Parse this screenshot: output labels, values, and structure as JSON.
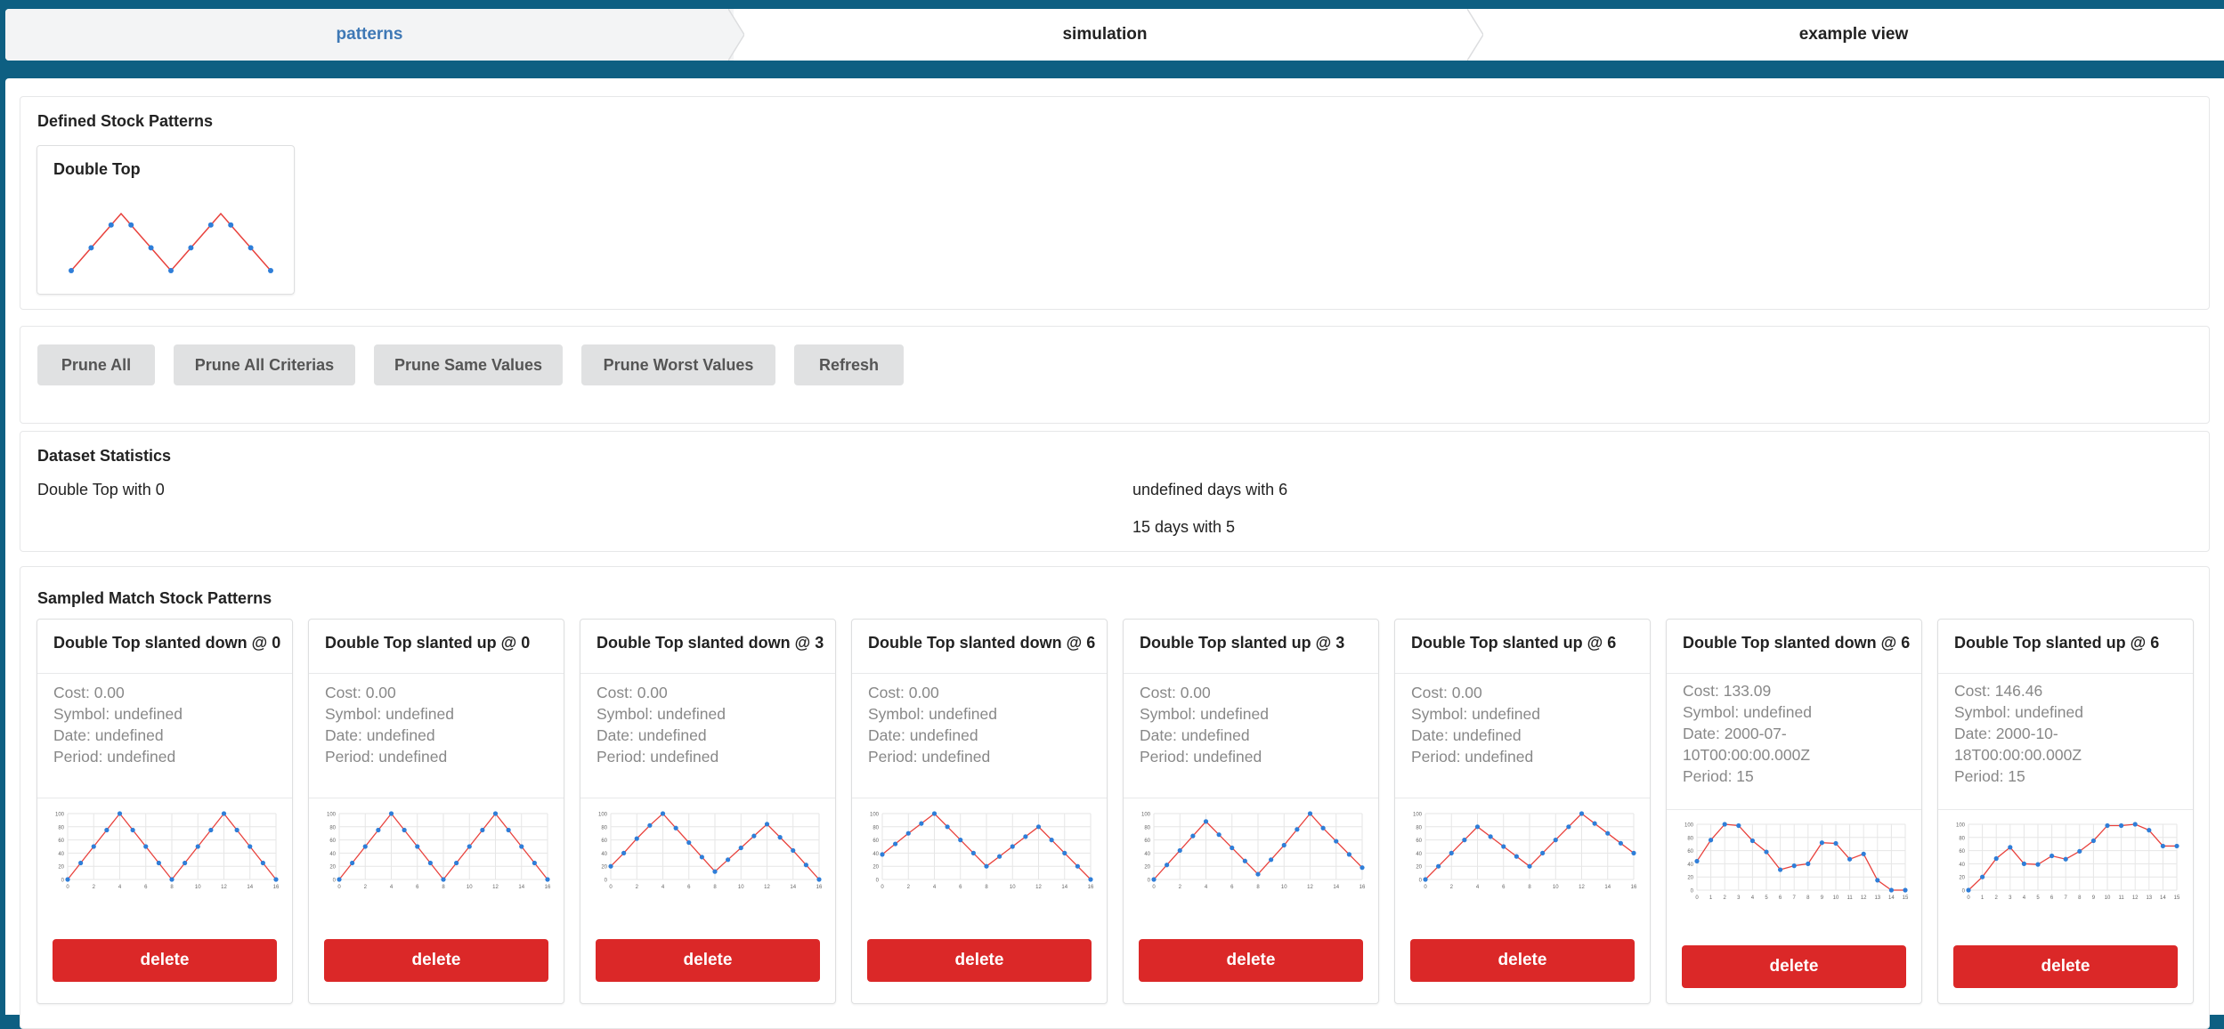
{
  "nav": {
    "steps": [
      {
        "label": "patterns"
      },
      {
        "label": "simulation"
      },
      {
        "label": "example view"
      }
    ]
  },
  "defined": {
    "title": "Defined Stock Patterns",
    "patterns": [
      {
        "name": "Double Top",
        "values": [
          0,
          20,
          40,
          60,
          80,
          100,
          80,
          60,
          40,
          20,
          0,
          20,
          40,
          60,
          80,
          100,
          80,
          60,
          40,
          20,
          0
        ]
      }
    ]
  },
  "toolbar": {
    "prune_all": "Prune All",
    "prune_all_criterias": "Prune All Criterias",
    "prune_same_values": "Prune Same Values",
    "prune_worst_values": "Prune Worst Values",
    "refresh": "Refresh"
  },
  "stats": {
    "title": "Dataset Statistics",
    "left": [
      "Double Top with 0"
    ],
    "right": [
      "undefined days with 6",
      "15 days with 5"
    ]
  },
  "sampled": {
    "title": "Sampled Match Stock Patterns",
    "delete_label": "delete",
    "colors": {
      "line": "#e8413c",
      "point": "#2f7ed8",
      "grid": "#e6e6e6",
      "delete": "#db2828"
    },
    "cards": [
      {
        "title": "Double Top slanted down @ 0",
        "cost": "Cost: 0.00",
        "symbol": "Symbol: undefined",
        "date": "Date: undefined",
        "period": "Period: undefined",
        "chart_data": {
          "type": "line",
          "x": [
            0,
            1,
            2,
            3,
            4,
            5,
            6,
            7,
            8,
            9,
            10,
            11,
            12,
            13,
            14,
            15,
            16
          ],
          "values": [
            0,
            25,
            50,
            75,
            100,
            75,
            50,
            25,
            0,
            25,
            50,
            75,
            100,
            75,
            50,
            25,
            0
          ],
          "ylim": [
            0,
            100
          ],
          "x_ticks": [
            "0",
            "2",
            "4",
            "6",
            "8",
            "10",
            "12",
            "14",
            "16"
          ],
          "y_ticks": [
            "0",
            "20",
            "40",
            "60",
            "80",
            "100"
          ]
        }
      },
      {
        "title": "Double Top slanted up @ 0",
        "cost": "Cost: 0.00",
        "symbol": "Symbol: undefined",
        "date": "Date: undefined",
        "period": "Period: undefined",
        "chart_data": {
          "type": "line",
          "x": [
            0,
            1,
            2,
            3,
            4,
            5,
            6,
            7,
            8,
            9,
            10,
            11,
            12,
            13,
            14,
            15,
            16
          ],
          "values": [
            0,
            25,
            50,
            75,
            100,
            75,
            50,
            25,
            0,
            25,
            50,
            75,
            100,
            75,
            50,
            25,
            0
          ],
          "ylim": [
            0,
            100
          ],
          "x_ticks": [
            "0",
            "2",
            "4",
            "6",
            "8",
            "10",
            "12",
            "14",
            "16"
          ],
          "y_ticks": [
            "0",
            "20",
            "40",
            "60",
            "80",
            "100"
          ]
        }
      },
      {
        "title": "Double Top slanted down @ 3",
        "cost": "Cost: 0.00",
        "symbol": "Symbol: undefined",
        "date": "Date: undefined",
        "period": "Period: undefined",
        "chart_data": {
          "type": "line",
          "x": [
            0,
            1,
            2,
            3,
            4,
            5,
            6,
            7,
            8,
            9,
            10,
            11,
            12,
            13,
            14,
            15,
            16
          ],
          "values": [
            20,
            40,
            62,
            82,
            100,
            78,
            56,
            34,
            12,
            30,
            48,
            66,
            84,
            64,
            44,
            22,
            0
          ],
          "ylim": [
            0,
            100
          ],
          "x_ticks": [
            "0",
            "2",
            "4",
            "6",
            "8",
            "10",
            "12",
            "14",
            "16"
          ],
          "y_ticks": [
            "0",
            "20",
            "40",
            "60",
            "80",
            "100"
          ]
        }
      },
      {
        "title": "Double Top slanted down @ 6",
        "cost": "Cost: 0.00",
        "symbol": "Symbol: undefined",
        "date": "Date: undefined",
        "period": "Period: undefined",
        "chart_data": {
          "type": "line",
          "x": [
            0,
            1,
            2,
            3,
            4,
            5,
            6,
            7,
            8,
            9,
            10,
            11,
            12,
            13,
            14,
            15,
            16
          ],
          "values": [
            38,
            54,
            70,
            85,
            100,
            80,
            60,
            40,
            20,
            35,
            50,
            65,
            80,
            60,
            40,
            20,
            0
          ],
          "ylim": [
            0,
            100
          ],
          "x_ticks": [
            "0",
            "2",
            "4",
            "6",
            "8",
            "10",
            "12",
            "14",
            "16"
          ],
          "y_ticks": [
            "0",
            "20",
            "40",
            "60",
            "80",
            "100"
          ]
        }
      },
      {
        "title": "Double Top slanted up @ 3",
        "cost": "Cost: 0.00",
        "symbol": "Symbol: undefined",
        "date": "Date: undefined",
        "period": "Period: undefined",
        "chart_data": {
          "type": "line",
          "x": [
            0,
            1,
            2,
            3,
            4,
            5,
            6,
            7,
            8,
            9,
            10,
            11,
            12,
            13,
            14,
            15,
            16
          ],
          "values": [
            0,
            22,
            44,
            66,
            88,
            68,
            48,
            28,
            8,
            30,
            52,
            76,
            100,
            78,
            58,
            38,
            18
          ],
          "ylim": [
            0,
            100
          ],
          "x_ticks": [
            "0",
            "2",
            "4",
            "6",
            "8",
            "10",
            "12",
            "14",
            "16"
          ],
          "y_ticks": [
            "0",
            "20",
            "40",
            "60",
            "80",
            "100"
          ]
        }
      },
      {
        "title": "Double Top slanted up @ 6",
        "cost": "Cost: 0.00",
        "symbol": "Symbol: undefined",
        "date": "Date: undefined",
        "period": "Period: undefined",
        "chart_data": {
          "type": "line",
          "x": [
            0,
            1,
            2,
            3,
            4,
            5,
            6,
            7,
            8,
            9,
            10,
            11,
            12,
            13,
            14,
            15,
            16
          ],
          "values": [
            0,
            20,
            40,
            60,
            80,
            65,
            50,
            35,
            20,
            40,
            60,
            80,
            100,
            85,
            70,
            55,
            40
          ],
          "ylim": [
            0,
            100
          ],
          "x_ticks": [
            "0",
            "2",
            "4",
            "6",
            "8",
            "10",
            "12",
            "14",
            "16"
          ],
          "y_ticks": [
            "0",
            "20",
            "40",
            "60",
            "80",
            "100"
          ]
        }
      },
      {
        "title": "Double Top slanted down @ 6",
        "cost": "Cost: 133.09",
        "symbol": "Symbol: undefined",
        "date": "Date: 2000-07-10T00:00:00.000Z",
        "period": "Period: 15",
        "chart_data": {
          "type": "line",
          "x": [
            0,
            1,
            2,
            3,
            4,
            5,
            6,
            7,
            8,
            9,
            10,
            11,
            12,
            13,
            14,
            15
          ],
          "values": [
            44,
            76,
            100,
            98,
            75,
            58,
            31,
            37,
            40,
            72,
            71,
            47,
            55,
            15,
            0,
            0
          ],
          "ylim": [
            0,
            100
          ],
          "x_ticks": [
            "0",
            "1",
            "2",
            "3",
            "4",
            "5",
            "6",
            "7",
            "8",
            "9",
            "10",
            "11",
            "12",
            "13",
            "14",
            "15"
          ],
          "y_ticks": [
            "0",
            "20",
            "40",
            "60",
            "80",
            "100"
          ]
        }
      },
      {
        "title": "Double Top slanted up @ 6",
        "cost": "Cost: 146.46",
        "symbol": "Symbol: undefined",
        "date": "Date: 2000-10-18T00:00:00.000Z",
        "period": "Period: 15",
        "chart_data": {
          "type": "line",
          "x": [
            0,
            1,
            2,
            3,
            4,
            5,
            6,
            7,
            8,
            9,
            10,
            11,
            12,
            13,
            14,
            15
          ],
          "values": [
            0,
            20,
            48,
            65,
            40,
            39,
            52,
            47,
            59,
            75,
            98,
            98,
            100,
            91,
            67,
            67
          ],
          "ylim": [
            0,
            100
          ],
          "x_ticks": [
            "0",
            "1",
            "2",
            "3",
            "4",
            "5",
            "6",
            "7",
            "8",
            "9",
            "10",
            "11",
            "12",
            "13",
            "14",
            "15"
          ],
          "y_ticks": [
            "0",
            "20",
            "40",
            "60",
            "80",
            "100"
          ]
        }
      }
    ]
  }
}
